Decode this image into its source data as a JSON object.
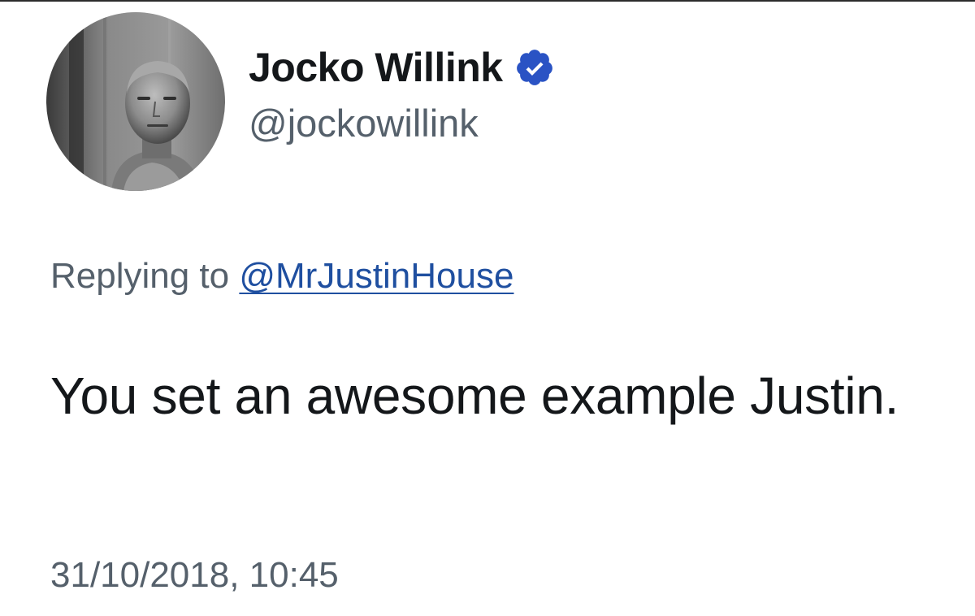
{
  "tweet": {
    "author": {
      "display_name": "Jocko Willink",
      "handle": "@jockowillink",
      "verified": true,
      "verified_icon": "verified-badge-icon",
      "avatar_icon": "profile-photo"
    },
    "reply": {
      "prefix": "Replying to ",
      "target": "@MrJustinHouse"
    },
    "text": "You set an awesome example Justin.",
    "timestamp": "31/10/2018, 10:45"
  },
  "colors": {
    "text_primary": "#14171a",
    "text_secondary": "#55606b",
    "link": "#1f4fa0",
    "verified_badge": "#2a53c4",
    "background": "#ffffff"
  }
}
